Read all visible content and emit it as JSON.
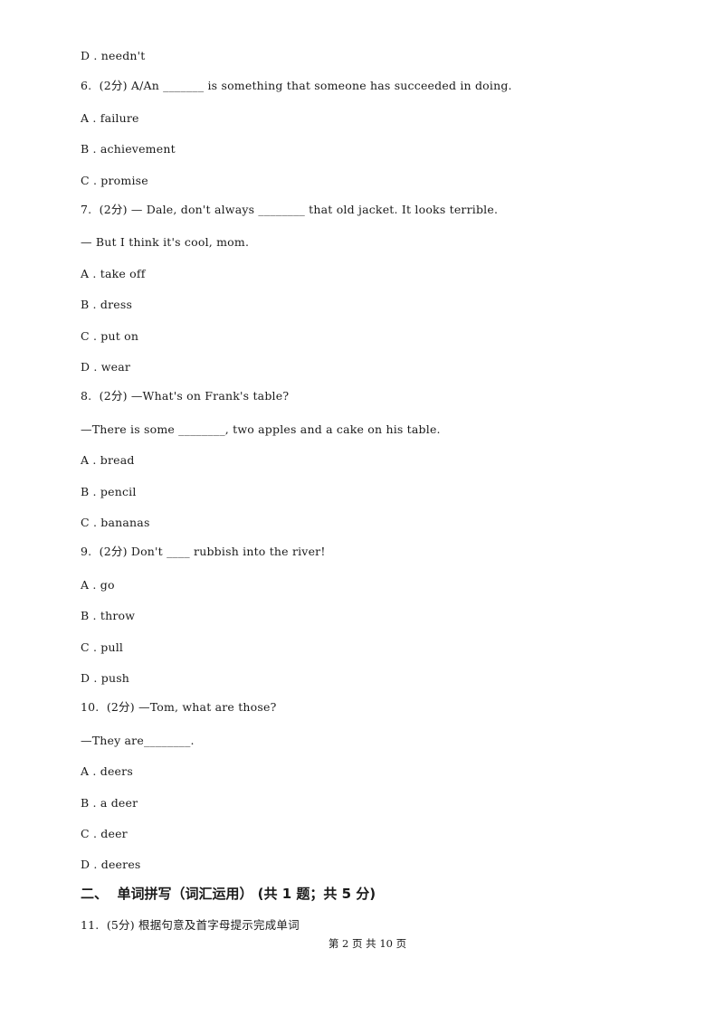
{
  "lines": [
    {
      "kind": "option",
      "text": "D . needn't"
    },
    {
      "kind": "question",
      "text": "6.  (2分) A/An _______ is something that someone has succeeded in doing."
    },
    {
      "kind": "option",
      "text": "A . failure"
    },
    {
      "kind": "option",
      "text": "B . achievement"
    },
    {
      "kind": "option",
      "text": "C . promise"
    },
    {
      "kind": "question",
      "text": "7.  (2分) — Dale, don't always ________ that old jacket. It looks terrible."
    },
    {
      "kind": "question-cont",
      "text": "— But I think it's cool, mom."
    },
    {
      "kind": "option",
      "text": "A . take off"
    },
    {
      "kind": "option",
      "text": "B . dress"
    },
    {
      "kind": "option",
      "text": "C . put on"
    },
    {
      "kind": "option",
      "text": "D . wear"
    },
    {
      "kind": "question",
      "text": "8.  (2分) —What's on Frank's table?"
    },
    {
      "kind": "question-cont",
      "text": "—There is some ________, two apples and a cake on his table."
    },
    {
      "kind": "option",
      "text": "A . bread"
    },
    {
      "kind": "option",
      "text": "B . pencil"
    },
    {
      "kind": "option",
      "text": "C . bananas"
    },
    {
      "kind": "question",
      "text": "9.  (2分) Don't ____ rubbish into the river!"
    },
    {
      "kind": "option",
      "text": "A . go"
    },
    {
      "kind": "option",
      "text": "B . throw"
    },
    {
      "kind": "option",
      "text": "C . pull"
    },
    {
      "kind": "option",
      "text": "D . push"
    },
    {
      "kind": "question",
      "text": "10.  (2分) —Tom, what are those?"
    },
    {
      "kind": "question-cont",
      "text": "—They are________."
    },
    {
      "kind": "option",
      "text": "A . deers"
    },
    {
      "kind": "option",
      "text": "B . a deer"
    },
    {
      "kind": "option",
      "text": "C . deer"
    },
    {
      "kind": "option",
      "text": "D . deeres"
    }
  ],
  "section_heading": "二、  单词拼写（词汇运用） (共 1 题；共 5 分)",
  "last_question": "11.  (5分) 根据句意及首字母提示完成单词",
  "footer": "第 2 页 共 10 页"
}
